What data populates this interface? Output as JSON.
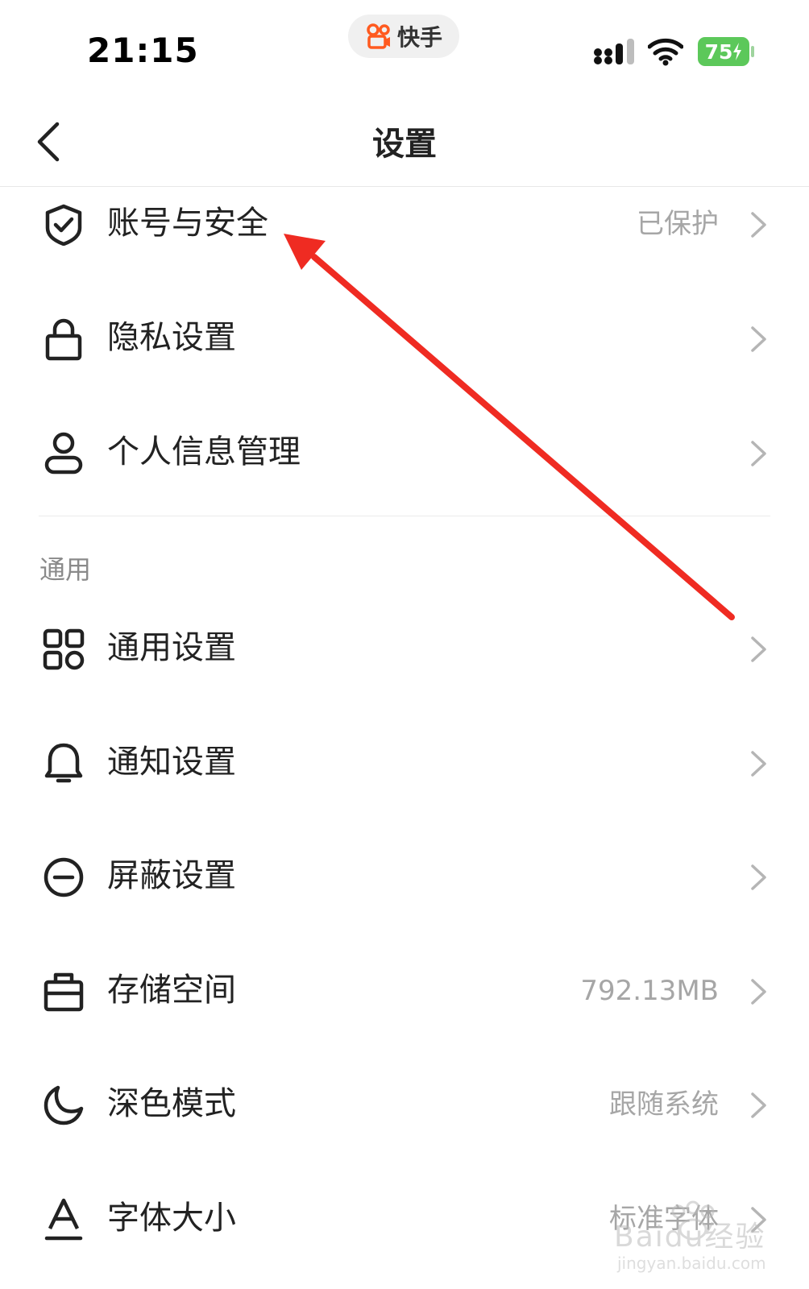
{
  "status_bar": {
    "time": "21:15",
    "app_pill_label": "快手",
    "battery": "75",
    "brand_color": "#ff5a1f",
    "battery_color": "#5cc85a"
  },
  "nav": {
    "title": "设置",
    "back_icon": "chevron-left-icon"
  },
  "sections": [
    {
      "header": "",
      "items": [
        {
          "icon": "shield-check-icon",
          "label": "账号与安全",
          "value": "已保护"
        },
        {
          "icon": "lock-icon",
          "label": "隐私设置",
          "value": ""
        },
        {
          "icon": "user-icon",
          "label": "个人信息管理",
          "value": ""
        }
      ]
    },
    {
      "header": "通用",
      "items": [
        {
          "icon": "grid-icon",
          "label": "通用设置",
          "value": ""
        },
        {
          "icon": "bell-icon",
          "label": "通知设置",
          "value": ""
        },
        {
          "icon": "block-icon",
          "label": "屏蔽设置",
          "value": ""
        },
        {
          "icon": "storage-box-icon",
          "label": "存储空间",
          "value": "792.13MB"
        },
        {
          "icon": "moon-icon",
          "label": "深色模式",
          "value": "跟随系统"
        },
        {
          "icon": "font-size-icon",
          "label": "字体大小",
          "value": "标准字体"
        }
      ]
    }
  ],
  "annotation": {
    "color": "#ef2b22"
  },
  "watermark": {
    "text": "Baidu经验",
    "sub": "jingyan.baidu.com"
  }
}
